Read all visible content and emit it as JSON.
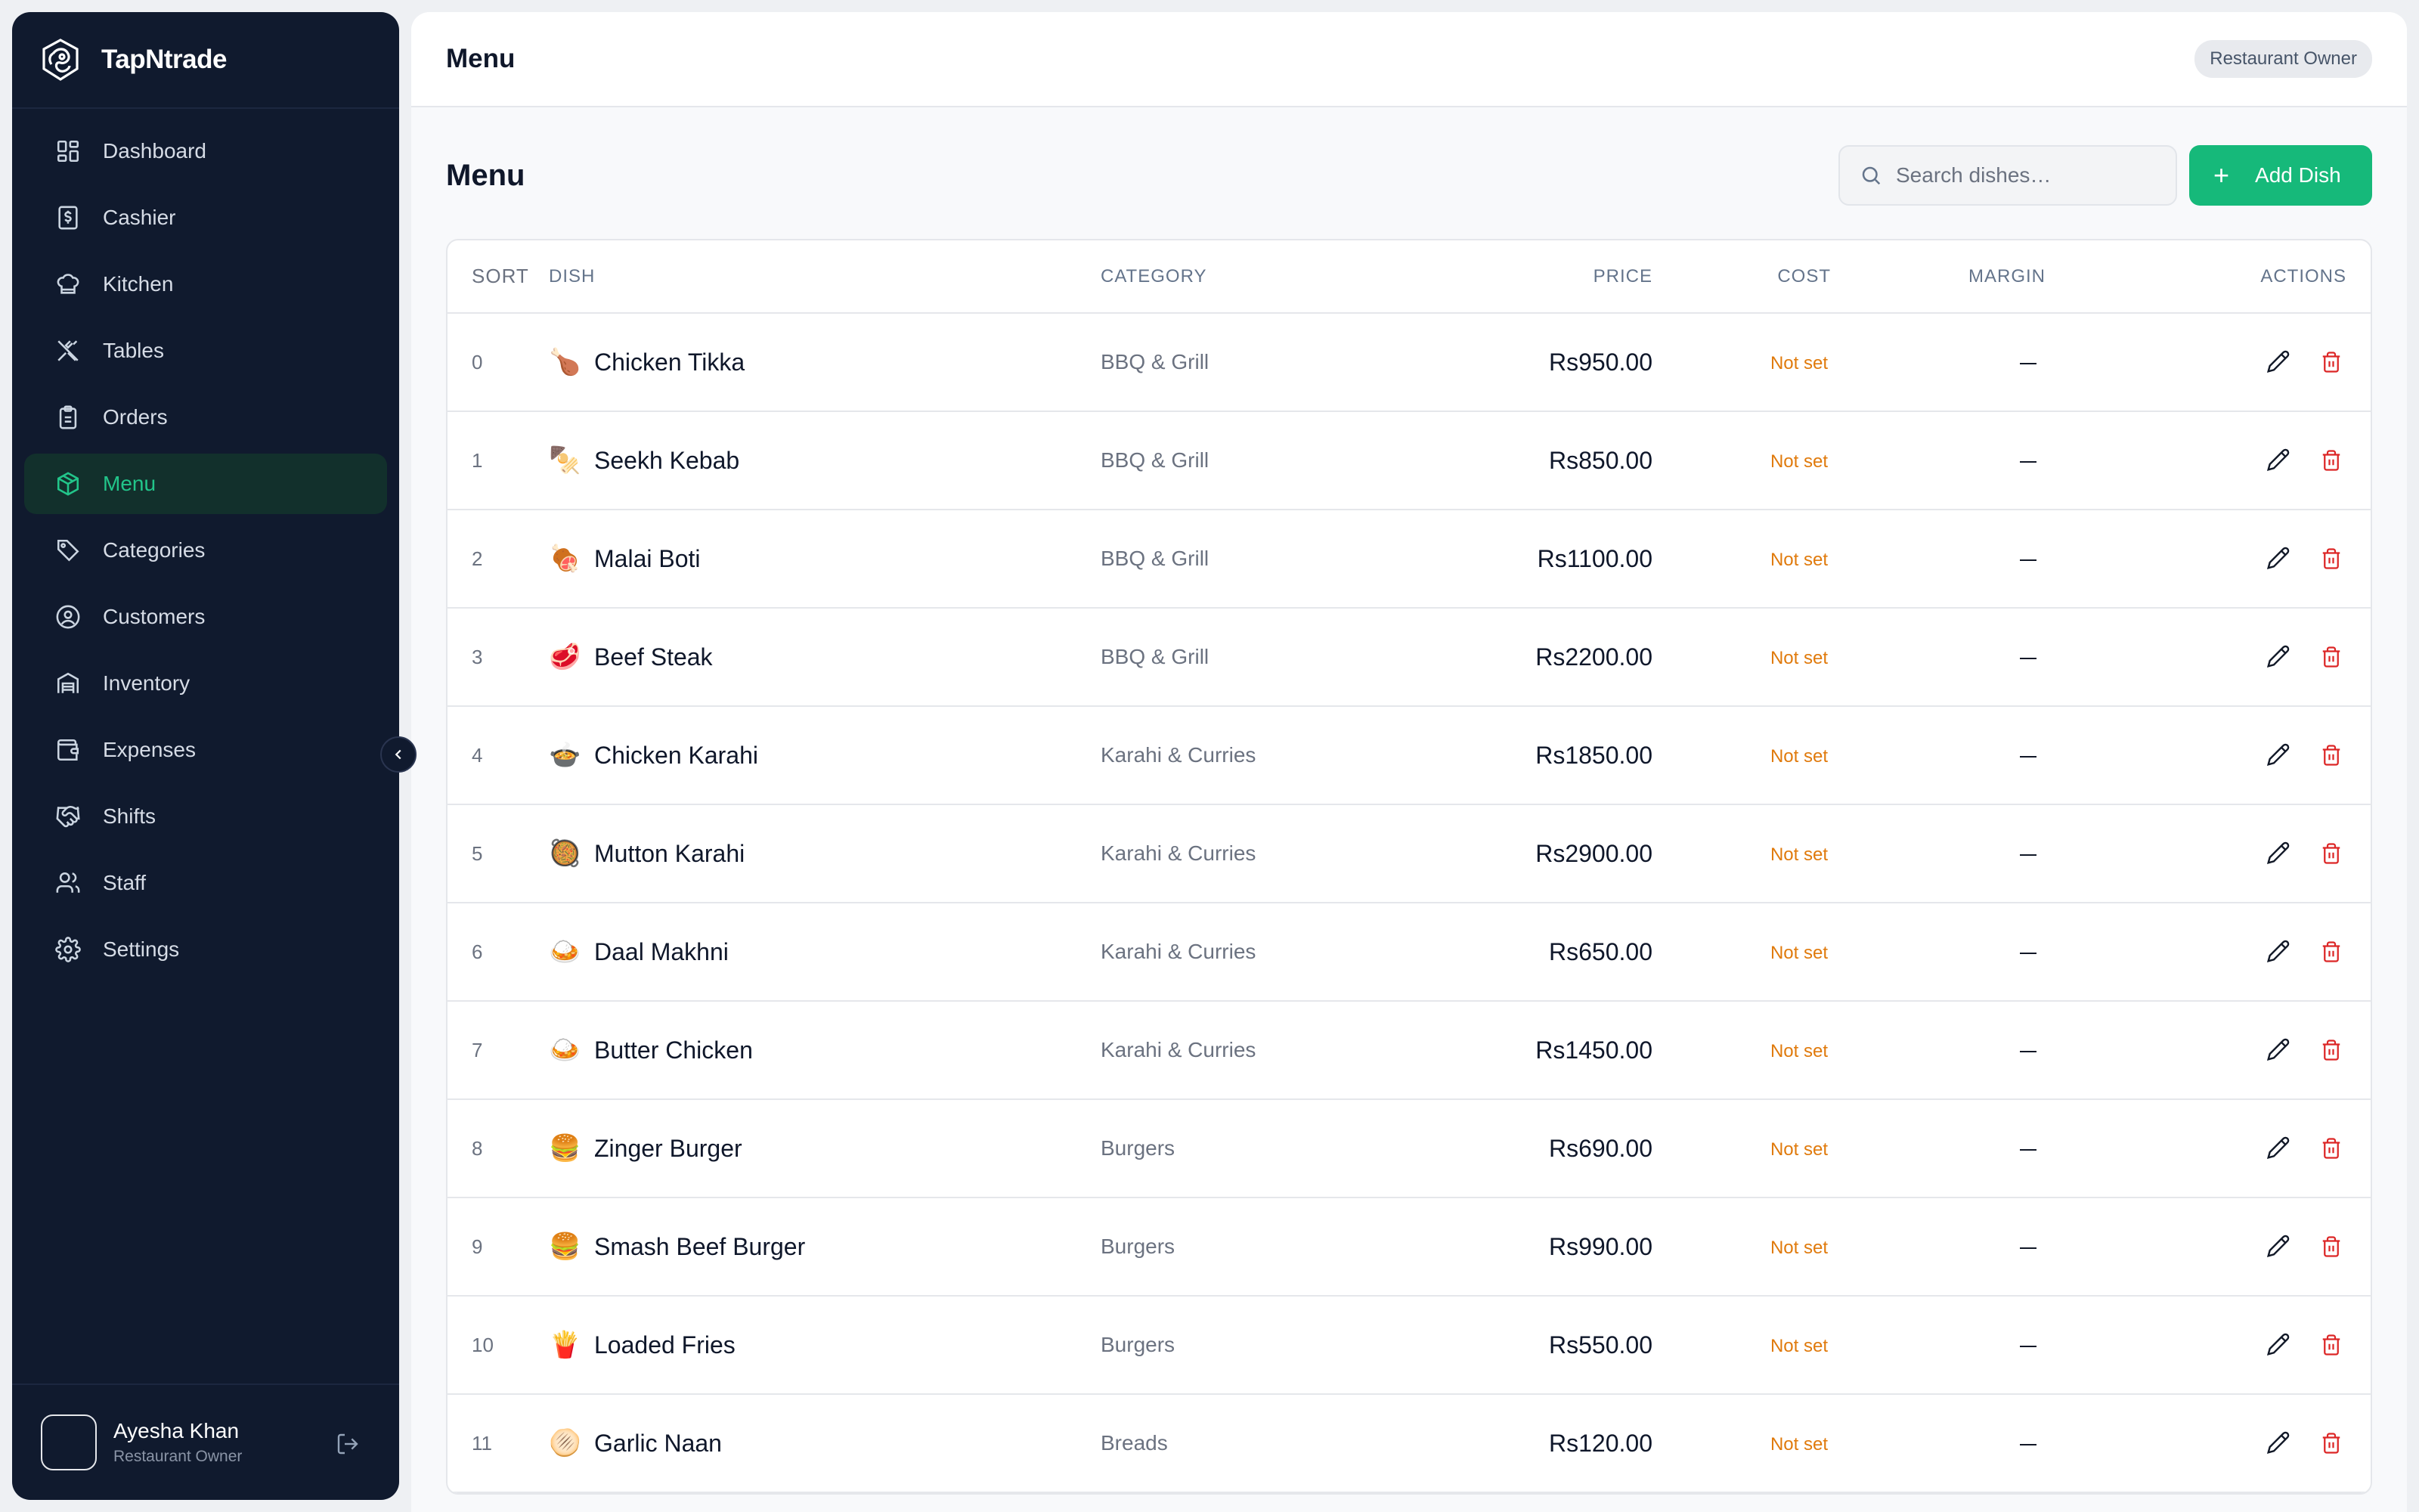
{
  "brand": {
    "name": "TapNtrade"
  },
  "sidebar": {
    "items": [
      {
        "label": "Dashboard",
        "icon": "dashboard-icon",
        "active": false
      },
      {
        "label": "Cashier",
        "icon": "cashier-icon",
        "active": false
      },
      {
        "label": "Kitchen",
        "icon": "chef-hat-icon",
        "active": false
      },
      {
        "label": "Tables",
        "icon": "utensils-icon",
        "active": false
      },
      {
        "label": "Orders",
        "icon": "clipboard-icon",
        "active": false
      },
      {
        "label": "Menu",
        "icon": "package-icon",
        "active": true
      },
      {
        "label": "Categories",
        "icon": "tag-icon",
        "active": false
      },
      {
        "label": "Customers",
        "icon": "user-circle-icon",
        "active": false
      },
      {
        "label": "Inventory",
        "icon": "warehouse-icon",
        "active": false
      },
      {
        "label": "Expenses",
        "icon": "wallet-icon",
        "active": false
      },
      {
        "label": "Shifts",
        "icon": "handshake-icon",
        "active": false
      },
      {
        "label": "Staff",
        "icon": "users-icon",
        "active": false
      },
      {
        "label": "Settings",
        "icon": "gear-icon",
        "active": false
      }
    ],
    "user": {
      "name": "Ayesha Khan",
      "role": "Restaurant Owner"
    }
  },
  "header": {
    "title": "Menu",
    "role_badge": "Restaurant Owner"
  },
  "main": {
    "title": "Menu",
    "search": {
      "placeholder": "Search dishes…",
      "value": ""
    },
    "add_button": "Add Dish"
  },
  "table": {
    "columns": {
      "sort": "SORT",
      "dish": "DISH",
      "category": "CATEGORY",
      "price": "PRICE",
      "cost": "COST",
      "margin": "MARGIN",
      "actions": "ACTIONS"
    },
    "rows": [
      {
        "sort": "0",
        "emoji": "🍗",
        "dish": "Chicken Tikka",
        "category": "BBQ & Grill",
        "price": "Rs950.00",
        "cost": "Not set",
        "margin": "—"
      },
      {
        "sort": "1",
        "emoji": "🍢",
        "dish": "Seekh Kebab",
        "category": "BBQ & Grill",
        "price": "Rs850.00",
        "cost": "Not set",
        "margin": "—"
      },
      {
        "sort": "2",
        "emoji": "🍖",
        "dish": "Malai Boti",
        "category": "BBQ & Grill",
        "price": "Rs1100.00",
        "cost": "Not set",
        "margin": "—"
      },
      {
        "sort": "3",
        "emoji": "🥩",
        "dish": "Beef Steak",
        "category": "BBQ & Grill",
        "price": "Rs2200.00",
        "cost": "Not set",
        "margin": "—"
      },
      {
        "sort": "4",
        "emoji": "🍲",
        "dish": "Chicken Karahi",
        "category": "Karahi & Curries",
        "price": "Rs1850.00",
        "cost": "Not set",
        "margin": "—"
      },
      {
        "sort": "5",
        "emoji": "🥘",
        "dish": "Mutton Karahi",
        "category": "Karahi & Curries",
        "price": "Rs2900.00",
        "cost": "Not set",
        "margin": "—"
      },
      {
        "sort": "6",
        "emoji": "🍛",
        "dish": "Daal Makhni",
        "category": "Karahi & Curries",
        "price": "Rs650.00",
        "cost": "Not set",
        "margin": "—"
      },
      {
        "sort": "7",
        "emoji": "🍛",
        "dish": "Butter Chicken",
        "category": "Karahi & Curries",
        "price": "Rs1450.00",
        "cost": "Not set",
        "margin": "—"
      },
      {
        "sort": "8",
        "emoji": "🍔",
        "dish": "Zinger Burger",
        "category": "Burgers",
        "price": "Rs690.00",
        "cost": "Not set",
        "margin": "—"
      },
      {
        "sort": "9",
        "emoji": "🍔",
        "dish": "Smash Beef Burger",
        "category": "Burgers",
        "price": "Rs990.00",
        "cost": "Not set",
        "margin": "—"
      },
      {
        "sort": "10",
        "emoji": "🍟",
        "dish": "Loaded Fries",
        "category": "Burgers",
        "price": "Rs550.00",
        "cost": "Not set",
        "margin": "—"
      },
      {
        "sort": "11",
        "emoji": "🫓",
        "dish": "Garlic Naan",
        "category": "Breads",
        "price": "Rs120.00",
        "cost": "Not set",
        "margin": "—"
      }
    ]
  },
  "colors": {
    "sidebar_bg": "#101a2e",
    "accent": "#16b97a",
    "active_text": "#22c58a",
    "warning": "#e07a0c",
    "danger": "#dc2626"
  }
}
